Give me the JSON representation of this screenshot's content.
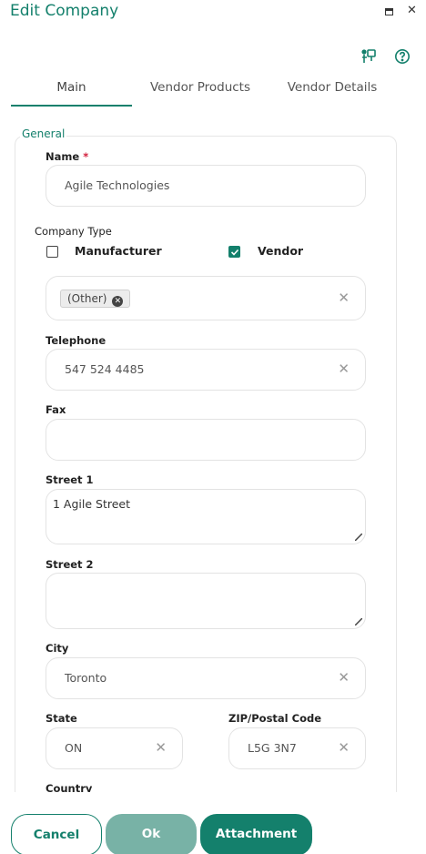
{
  "window": {
    "title": "Edit Company",
    "maximize_icon": "maximize-icon",
    "close_label": "✕"
  },
  "toolbar": {
    "presentation_icon": "presentation-icon",
    "help_icon": "help-icon"
  },
  "tabs": [
    {
      "label": "Main",
      "active": true
    },
    {
      "label": "Vendor Products",
      "active": false
    },
    {
      "label": "Vendor Details",
      "active": false
    }
  ],
  "form": {
    "section_label": "General",
    "name": {
      "label": "Name",
      "required_mark": "*",
      "value": "Agile Technologies"
    },
    "company_type": {
      "label": "Company Type",
      "manufacturer": {
        "label": "Manufacturer",
        "checked": false
      },
      "vendor": {
        "label": "Vendor",
        "checked": true
      },
      "selected_chip": "(Other)"
    },
    "telephone": {
      "label": "Telephone",
      "value": "547 524 4485"
    },
    "fax": {
      "label": "Fax",
      "value": ""
    },
    "street1": {
      "label": "Street 1",
      "value": "1 Agile Street"
    },
    "street2": {
      "label": "Street 2",
      "value": ""
    },
    "city": {
      "label": "City",
      "value": "Toronto"
    },
    "state": {
      "label": "State",
      "value": "ON"
    },
    "zip": {
      "label": "ZIP/Postal Code",
      "value": "L5G 3N7"
    },
    "country": {
      "label": "Country"
    }
  },
  "footer": {
    "cancel_label": "Cancel",
    "ok_label": "Ok",
    "attachment_label": "Attachment"
  },
  "colors": {
    "accent": "#14806c",
    "ok_disabled": "#78b2a6",
    "required": "#d21f3c"
  }
}
